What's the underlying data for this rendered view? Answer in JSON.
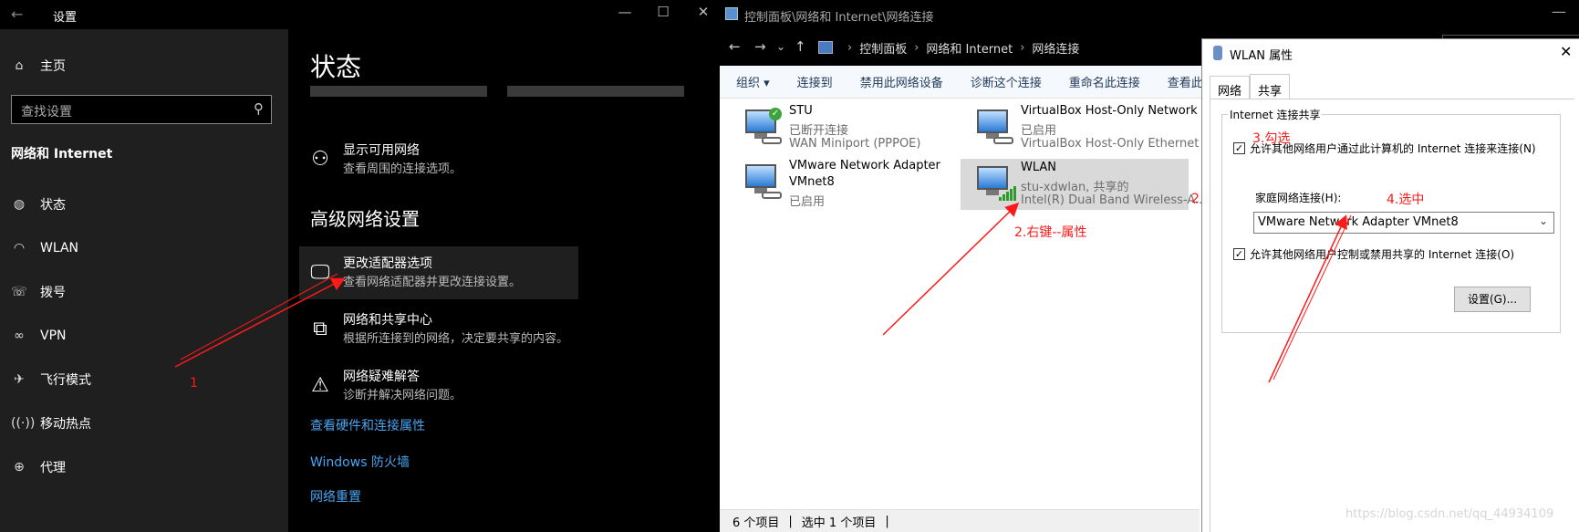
{
  "settings": {
    "title": "设置",
    "nav": {
      "home": "主页",
      "search_placeholder": "查找设置",
      "section": "网络和 Internet",
      "items": [
        "状态",
        "WLAN",
        "拨号",
        "VPN",
        "飞行模式",
        "移动热点",
        "代理"
      ]
    },
    "content": {
      "title": "状态",
      "rows": [
        {
          "title": "显示可用网络",
          "desc": "查看周围的连接选项。"
        },
        {
          "title": "更改适配器选项",
          "desc": "查看网络适配器并更改连接设置。"
        },
        {
          "title": "网络和共享中心",
          "desc": "根据所连接到的网络，决定要共享的内容。"
        },
        {
          "title": "网络疑难解答",
          "desc": "诊断并解决网络问题。"
        }
      ],
      "advanced_title": "高级网络设置",
      "links": [
        "查看硬件和连接属性",
        "Windows 防火墙",
        "网络重置"
      ]
    }
  },
  "control_panel": {
    "title": "控制面板\\网络和 Internet\\网络连接",
    "breadcrumb": [
      "控制面板",
      "网络和 Internet",
      "网络连接"
    ],
    "toolbar": [
      "组织 ▾",
      "连接到",
      "禁用此网络设备",
      "诊断这个连接",
      "重命名此连接",
      "查看此连接"
    ],
    "adapters": [
      {
        "name": "STU",
        "line1": "已断开连接",
        "line2": "WAN Miniport (PPPOE)"
      },
      {
        "name": "VirtualBox Host-Only Network",
        "line1": "已启用",
        "line2": "VirtualBox Host-Only Ethernet ..."
      },
      {
        "name": "VMware Network Adapter",
        "name2": "VMnet8",
        "line1": "已启用"
      },
      {
        "name": "WLAN",
        "line1": "stu-xdwlan, 共享的",
        "line2": "Intel(R) Dual Band Wireless-A..."
      }
    ],
    "status": {
      "count": "6 个项目",
      "selected": "选中 1 个项目"
    }
  },
  "dialog": {
    "title": "WLAN 属性",
    "tabs": [
      "网络",
      "共享"
    ],
    "group_title": "Internet 连接共享",
    "allow_share": "允许其他网络用户通过此计算机的 Internet 连接来连接(N)",
    "home_label": "家庭网络连接(H):",
    "home_value": "VMware Network Adapter VMnet8",
    "allow_control": "允许其他网络用户控制或禁用共享的 Internet 连接(O)",
    "settings_button": "设置(G)..."
  },
  "annotations": {
    "a1": "1",
    "a2": "2.右键--属性",
    "a3": "3.勾选",
    "a4": "4.选中",
    "a5": "2"
  },
  "watermark": "https://blog.csdn.net/qq_44934109",
  "colors": {
    "annotation": "#ff1a1a",
    "link": "#4aa4f0",
    "settings_bg": "#000000",
    "nav_bg": "#1f1f1f"
  }
}
